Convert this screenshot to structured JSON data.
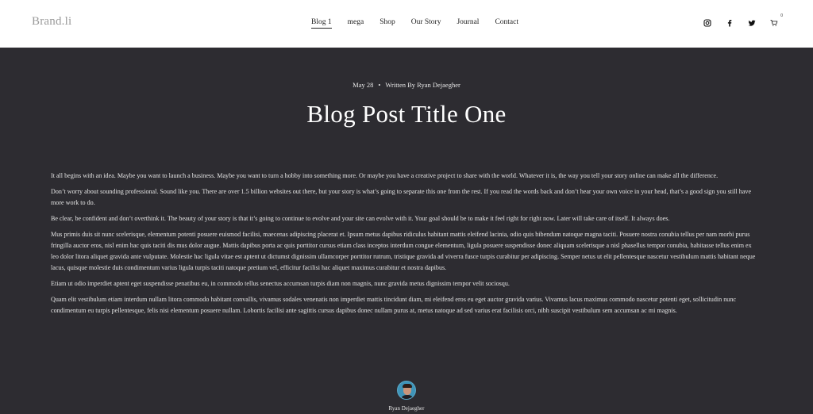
{
  "header": {
    "logo": "Brand.li",
    "nav": [
      {
        "label": "Blog 1",
        "active": true
      },
      {
        "label": "mega",
        "active": false
      },
      {
        "label": "Shop",
        "active": false
      },
      {
        "label": "Our Story",
        "active": false
      },
      {
        "label": "Journal",
        "active": false
      },
      {
        "label": "Contact",
        "active": false
      }
    ],
    "icons": [
      "instagram-icon",
      "facebook-icon",
      "twitter-icon",
      "cart-icon"
    ],
    "cart_count": "0"
  },
  "post": {
    "date": "May 28",
    "separator": "•",
    "byline": "Written By Ryan Dejaegher",
    "title": "Blog Post Title One",
    "paragraphs": [
      "It all begins with an idea. Maybe you want to launch a business. Maybe you want to turn a hobby into something more. Or maybe you have a creative project to share with the world. Whatever it is, the way you tell your story online can make all the difference.",
      "Don’t worry about sounding professional. Sound like you. There are over 1.5 billion websites out there, but your story is what’s going to separate this one from the rest. If you read the words back and don’t hear your own voice in your head, that’s a good sign you still have more work to do.",
      "Be clear, be confident and don’t overthink it. The beauty of your story is that it’s going to continue to evolve and your site can evolve with it. Your goal should be to make it feel right for right now. Later will take care of itself. It always does.",
      "Mus primis duis sit nunc scelerisque, elementum potenti posuere euismod facilisi, maecenas adipiscing placerat et. Ipsum metus dapibus ridiculus habitant mattis eleifend lacinia, odio quis bibendum natoque magna taciti. Posuere nostra conubia tellus per nam morbi purus fringilla auctor eros, nisl enim hac quis taciti dis mus dolor augue. Mattis dapibus porta ac quis porttitor cursus etiam class inceptos interdum congue elementum, ligula posuere suspendisse donec aliquam scelerisque a nisl phasellus tempor conubia, habitasse tellus enim ex leo dolor litora aliquet gravida ante vulputate. Molestie hac ligula vitae est aptent ut dictumst dignissim ullamcorper porttitor rutrum, tristique gravida ad viverra fusce turpis curabitur per adipiscing. Semper netus ut elit pellentesque nascetur vestibulum mattis habitant neque lacus, quisque molestie duis condimentum varius ligula turpis taciti natoque pretium vel, efficitur facilisi hac aliquet maximus curabitur et nostra dapibus.",
      "Etiam ut odio imperdiet aptent eget suspendisse penatibus eu, in commodo tellus senectus accumsan turpis diam non magnis, nunc gravida metus dignissim tempor velit sociosqu.",
      "Quam elit vestibulum etiam interdum nullam litora commodo habitant convallis, vivamus sodales venenatis non imperdiet mattis tincidunt diam, mi eleifend eros eu eget auctor gravida varius. Vivamus lacus maximus commodo nascetur potenti eget, sollicitudin nunc condimentum eu turpis pellentesque, felis nisi elementum posuere nullam. Lobortis facilisi ante sagittis cursus dapibus donec nullam purus at, metus natoque ad sed varius erat facilisis orci, nibh suscipit vestibulum sem accumsan ac mi magnis."
    ],
    "author_name": "Ryan Dejaegher"
  },
  "colors": {
    "article_bg": "#2d2c31",
    "header_bg": "#ffffff",
    "text_light": "#e4e4e4",
    "avatar_bg": "#3e94b8"
  }
}
